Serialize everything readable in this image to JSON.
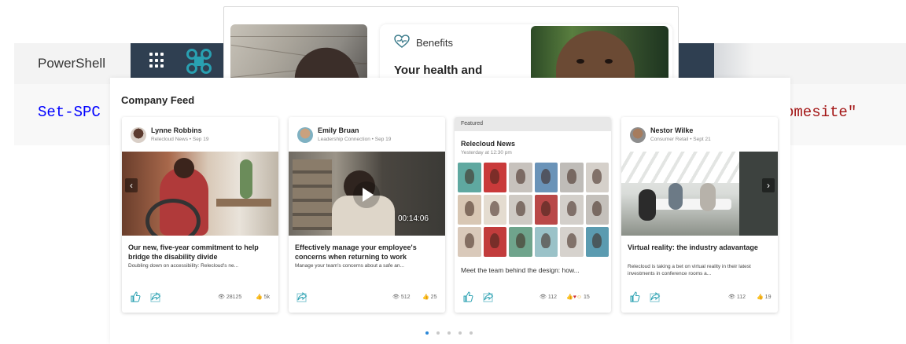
{
  "docs": {
    "tab_label": "PowerShell",
    "code_left": "Set-SPC",
    "code_right": "omesite\""
  },
  "app_icons": [
    "waffle-icon",
    "app-logo-icon"
  ],
  "benefits": {
    "title": "Benefits",
    "headline": "Your health and",
    "icon": "heart-pulse-icon"
  },
  "feed": {
    "title": "Company Feed",
    "cards": [
      {
        "author": "Lynne Robbins",
        "source": "Relecloud News • Sep 19",
        "headline": "Our new, five-year commitment to help bridge the disability divide",
        "description": "Doubling down on accessibility: Relecloud's ne...",
        "views": "28125",
        "likes": "5k"
      },
      {
        "author": "Emily Bruan",
        "source": "Leadership Connection • Sep 19",
        "headline": "Effectively manage your employee's concerns when returning to work",
        "description": "Manage your team's concerns about a safe an...",
        "duration": "00:14:06",
        "views": "512",
        "likes": "25"
      },
      {
        "featured_label": "Featured",
        "title": "Relecloud News",
        "subtitle": "Yesterday at 12:30 pm",
        "description": "Meet the team behind the design: how...",
        "views": "112",
        "reactions": "15"
      },
      {
        "author": "Nestor Wilke",
        "source": "Consumer Retail • Sept 21",
        "headline": "Virtual reality: the industry adavantage",
        "description": "Relecloud is taking a bet on virtual reality in their latest investments in conference rooms a...",
        "views": "112",
        "likes": "19"
      }
    ],
    "pagination": {
      "pages": 5,
      "active": 1
    }
  },
  "colors": {
    "appbar": "#2f3f51",
    "accent": "#2b88d8",
    "icon_teal": "#29a0b1"
  }
}
